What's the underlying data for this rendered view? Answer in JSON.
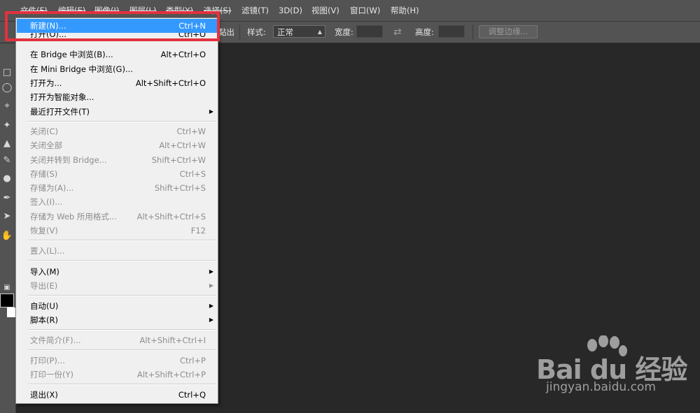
{
  "menubar": {
    "items": [
      {
        "label": "文件(F)"
      },
      {
        "label": "编辑(E)"
      },
      {
        "label": "图像(I)"
      },
      {
        "label": "图层(L)"
      },
      {
        "label": "类型(Y)"
      },
      {
        "label": "选择(S)"
      },
      {
        "label": "滤镜(T)"
      },
      {
        "label": "3D(D)"
      },
      {
        "label": "视图(V)"
      },
      {
        "label": "窗口(W)"
      },
      {
        "label": "帮助(H)"
      }
    ]
  },
  "options_bar": {
    "partial_label": "黏出",
    "style_label": "样式:",
    "style_value": "正常",
    "width_label": "宽度:",
    "height_label": "高度:",
    "refine_edge_button": "调整边缘..."
  },
  "file_menu": {
    "items": [
      {
        "label": "新建(N)...",
        "shortcut": "Ctrl+N",
        "highlighted": true
      },
      {
        "label": "打开(O)...",
        "shortcut": "Ctrl+O"
      },
      {
        "label": "在 Bridge 中浏览(B)...",
        "shortcut": "Alt+Ctrl+O"
      },
      {
        "label": "在 Mini Bridge 中浏览(G)...",
        "shortcut": ""
      },
      {
        "label": "打开为...",
        "shortcut": "Alt+Shift+Ctrl+O"
      },
      {
        "label": "打开为智能对象...",
        "shortcut": ""
      },
      {
        "label": "最近打开文件(T)",
        "shortcut": "",
        "submenu": true
      },
      {
        "label": "关闭(C)",
        "shortcut": "Ctrl+W",
        "disabled": true
      },
      {
        "label": "关闭全部",
        "shortcut": "Alt+Ctrl+W",
        "disabled": true
      },
      {
        "label": "关闭并转到 Bridge...",
        "shortcut": "Shift+Ctrl+W",
        "disabled": true
      },
      {
        "label": "存储(S)",
        "shortcut": "Ctrl+S",
        "disabled": true
      },
      {
        "label": "存储为(A)...",
        "shortcut": "Shift+Ctrl+S",
        "disabled": true
      },
      {
        "label": "签入(I)...",
        "shortcut": "",
        "disabled": true
      },
      {
        "label": "存储为 Web 所用格式...",
        "shortcut": "Alt+Shift+Ctrl+S",
        "disabled": true
      },
      {
        "label": "恢复(V)",
        "shortcut": "F12",
        "disabled": true
      },
      {
        "label": "置入(L)...",
        "shortcut": "",
        "disabled": true
      },
      {
        "label": "导入(M)",
        "shortcut": "",
        "submenu": true
      },
      {
        "label": "导出(E)",
        "shortcut": "",
        "submenu": true,
        "disabled": true
      },
      {
        "label": "自动(U)",
        "shortcut": "",
        "submenu": true
      },
      {
        "label": "脚本(R)",
        "shortcut": "",
        "submenu": true
      },
      {
        "label": "文件简介(F)...",
        "shortcut": "Alt+Shift+Ctrl+I",
        "disabled": true
      },
      {
        "label": "打印(P)...",
        "shortcut": "Ctrl+P",
        "disabled": true
      },
      {
        "label": "打印一份(Y)",
        "shortcut": "Alt+Shift+Ctrl+P",
        "disabled": true
      },
      {
        "label": "退出(X)",
        "shortcut": "Ctrl+Q"
      }
    ]
  },
  "watermark": {
    "logo": "Bai du 经验",
    "url": "jingyan.baidu.com"
  },
  "colors": {
    "highlight": "#3399ff",
    "annotation_box": "#e3313e",
    "workspace": "#282828",
    "chrome": "#535353"
  }
}
